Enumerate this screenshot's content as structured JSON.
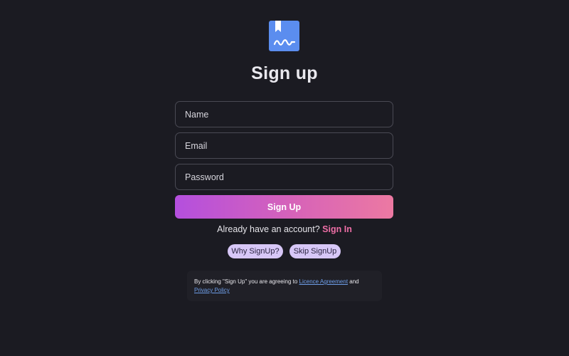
{
  "app": {
    "logo_icon": "book-signature-icon",
    "title": "Sign up"
  },
  "form": {
    "name_placeholder": "Name",
    "email_placeholder": "Email",
    "password_placeholder": "Password",
    "submit_label": "Sign Up"
  },
  "signin": {
    "prompt": "Already have an account?",
    "link_label": "Sign In"
  },
  "pills": {
    "why_label": "Why SignUp?",
    "skip_label": "Skip SignUp"
  },
  "notice": {
    "prefix": "By clicking \"Sign Up\" you are agreeing to",
    "licence_link": "Licence Agreement",
    "conjunction": "and",
    "privacy_link": "Privacy Policy"
  },
  "colors": {
    "background": "#1b1b22",
    "accent_pink": "#ee6ea6",
    "gradient_start": "#b44fde",
    "gradient_end": "#ec79a2",
    "logo_blue": "#5b8def",
    "pill_bg": "#d7c7f7",
    "link_blue": "#6e9ee8"
  }
}
